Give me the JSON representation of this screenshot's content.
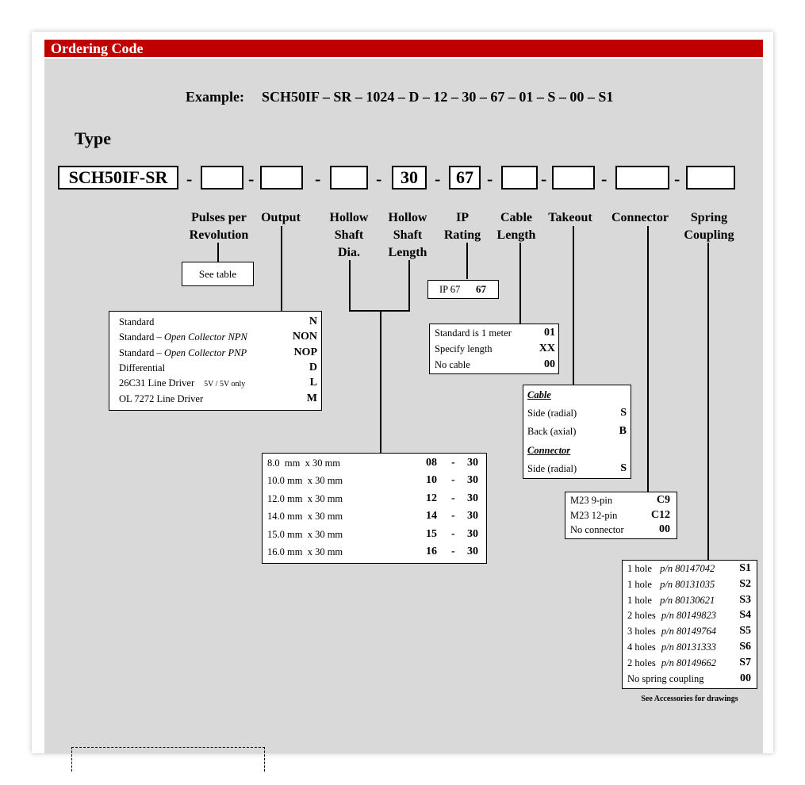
{
  "header": {
    "title": "Ordering Code"
  },
  "example": {
    "label": "Example:",
    "code": "SCH50IF – SR – 1024 – D – 12 – 30 – 67 – 01 – S – 00 – S1"
  },
  "type_label": "Type",
  "code_boxes": {
    "prefix": "SCH50IF-SR",
    "hollow_length": "30",
    "ip": "67",
    "dash": "-"
  },
  "labels": {
    "pulses": "Pulses per Revolution",
    "output": "Output",
    "hollow_dia": "Hollow Shaft Dia.",
    "hollow_len": "Hollow Shaft Length",
    "ip": "IP Rating",
    "cable": "Cable Length",
    "takeout": "Takeout",
    "connector": "Connector",
    "spring": "Spring Coupling"
  },
  "see_table": "See table",
  "ip_box": {
    "text": "IP 67",
    "code": "67"
  },
  "cable_rows": [
    {
      "text": "Standard is 1 meter",
      "code": "01"
    },
    {
      "text": "Specify length",
      "code": "XX"
    },
    {
      "text": "No cable",
      "code": "00"
    }
  ],
  "output_rows": [
    {
      "a": "Standard",
      "b": "",
      "c": "",
      "code": "N"
    },
    {
      "a": "Standard – ",
      "b": "Open Collector  NPN",
      "c": "",
      "code": "NON"
    },
    {
      "a": "Standard – ",
      "b": "Open Collector  PNP",
      "c": "",
      "code": "NOP"
    },
    {
      "a": "Differential",
      "b": "",
      "c": "",
      "code": "D"
    },
    {
      "a": "26C31 Line Driver",
      "b": "",
      "c": "5V / 5V only",
      "code": "L"
    },
    {
      "a": "OL 7272 Line Driver",
      "b": "",
      "c": "",
      "code": "M"
    }
  ],
  "takeout": {
    "cable_heading": "Cable",
    "cable_rows": [
      {
        "text": "Side  (radial)",
        "code": "S"
      },
      {
        "text": "Back (axial)",
        "code": "B"
      }
    ],
    "connector_heading": "Connector",
    "connector_rows": [
      {
        "text": "Side  (radial)",
        "code": "S"
      }
    ]
  },
  "connector_rows": [
    {
      "text": "M23   9-pin",
      "code": "C9"
    },
    {
      "text": "M23   12-pin",
      "code": "C12"
    },
    {
      "text": "No connector",
      "code": "00"
    }
  ],
  "shaft_rows": [
    {
      "text": "8.0  mm  x 30 mm",
      "dia": "08",
      "sep": "-",
      "len": "30"
    },
    {
      "text": "10.0 mm  x 30 mm",
      "dia": "10",
      "sep": "-",
      "len": "30"
    },
    {
      "text": "12.0 mm  x 30 mm",
      "dia": "12",
      "sep": "-",
      "len": "30"
    },
    {
      "text": "14.0 mm  x 30 mm",
      "dia": "14",
      "sep": "-",
      "len": "30"
    },
    {
      "text": "15.0 mm  x 30 mm",
      "dia": "15",
      "sep": "-",
      "len": "30"
    },
    {
      "text": "16.0 mm  x 30 mm",
      "dia": "16",
      "sep": "-",
      "len": "30"
    }
  ],
  "spring_rows": [
    {
      "a": "1 hole  ",
      "pn": "p/n 80147042",
      "code": "S1"
    },
    {
      "a": "1 hole  ",
      "pn": "p/n 80131035",
      "code": "S2"
    },
    {
      "a": "1 hole  ",
      "pn": "p/n 80130621",
      "code": "S3"
    },
    {
      "a": "2 holes ",
      "pn": "p/n 80149823",
      "code": "S4"
    },
    {
      "a": "3 holes ",
      "pn": "p/n 80149764",
      "code": "S5"
    },
    {
      "a": "4 holes ",
      "pn": "p/n 80131333",
      "code": "S6"
    },
    {
      "a": "2 holes ",
      "pn": "p/n 80149662",
      "code": "S7"
    },
    {
      "a": "No spring coupling",
      "pn": "",
      "code": "00"
    }
  ],
  "accessories_note": "See Accessories for drawings"
}
